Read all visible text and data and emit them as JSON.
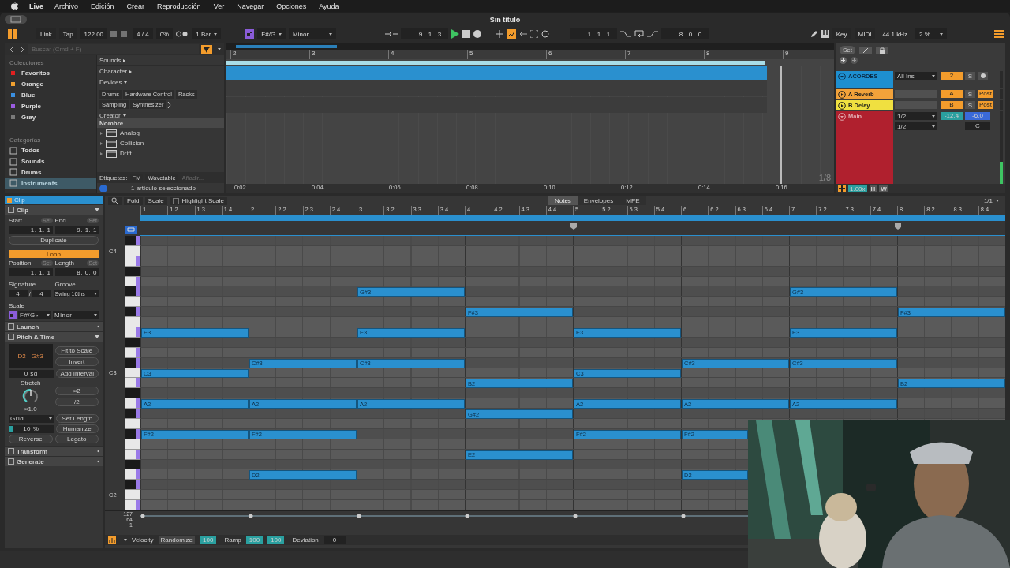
{
  "menubar": {
    "app": "Live",
    "items": [
      "Archivo",
      "Edición",
      "Crear",
      "Reproducción",
      "Ver",
      "Navegar",
      "Opciones",
      "Ayuda"
    ]
  },
  "window": {
    "title": "Sin título"
  },
  "control_bar": {
    "link": "Link",
    "tap": "Tap",
    "tempo": "122.00",
    "signature": "4 / 4",
    "groove": "0%",
    "quantize": "1 Bar",
    "scale_root": "F#/G",
    "scale_name": "Minor",
    "position": "9. 1. 3",
    "loop_start": "1. 1. 1",
    "loop_length": "8. 0. 0",
    "key": "Key",
    "midi": "MIDI",
    "sample_rate": "44.1 kHz",
    "cpu": "2 %"
  },
  "browser": {
    "search": {
      "placeholder": "Buscar (Cmd + F)"
    },
    "collections_title": "Colecciones",
    "collections": [
      {
        "label": "Favoritos",
        "color": "#e02020"
      },
      {
        "label": "Orange",
        "color": "#f0a030"
      },
      {
        "label": "Blue",
        "color": "#3a8fe0"
      },
      {
        "label": "Purple",
        "color": "#9a5ce0"
      },
      {
        "label": "Gray",
        "color": "#7a7a7a"
      }
    ],
    "categories_title": "Categorías",
    "categories": [
      {
        "label": "Todos",
        "selected": false
      },
      {
        "label": "Sounds",
        "selected": false
      },
      {
        "label": "Drums",
        "selected": false
      },
      {
        "label": "Instruments",
        "selected": true
      }
    ],
    "filters": [
      {
        "label": "Sounds",
        "expanded": false
      },
      {
        "label": "Character",
        "expanded": false
      },
      {
        "label": "Devices",
        "expanded": true,
        "tags": [
          "Drums",
          "Hardware Control",
          "Racks",
          "Sampling",
          "Synthesizer"
        ]
      },
      {
        "label": "Creator",
        "expanded": true
      }
    ],
    "list_header": "Nombre",
    "items": [
      {
        "label": "Analog"
      },
      {
        "label": "Collision"
      },
      {
        "label": "Drift"
      }
    ],
    "tags_label": "Etiquetas:",
    "tags": [
      "FM",
      "Wavetable"
    ],
    "tag_placeholder": "Añadir...",
    "status": "1 artículo seleccionado"
  },
  "arrangement": {
    "bars": [
      "2",
      "3",
      "4",
      "5",
      "6",
      "7",
      "8",
      "9"
    ],
    "times": [
      "0:02",
      "0:04",
      "0:06",
      "0:08",
      "0:10",
      "0:12",
      "0:14",
      "0:16"
    ],
    "grid": "1/8"
  },
  "mixer": {
    "set": "Set",
    "tracks": [
      {
        "kind": "midi",
        "name": "ACORDES",
        "color": "#1e8fd0",
        "expanded": true,
        "routing": [
          "All Ins"
        ],
        "send": "2",
        "solo": "S"
      },
      {
        "kind": "return",
        "name": "A Reverb",
        "color": "#f2a23a",
        "expanded": false,
        "send": "A",
        "solo": "S",
        "post": "Post"
      },
      {
        "kind": "return",
        "name": "B Delay",
        "color": "#f0e040",
        "expanded": false,
        "send": "B",
        "solo": "S",
        "post": "Post"
      },
      {
        "kind": "main",
        "name": "Main",
        "color": "#b0202e",
        "expanded": true,
        "routing": [
          "1/2",
          "1/2"
        ],
        "volume": "-12.4",
        "pan": "-6.0",
        "pan_label": "C"
      }
    ],
    "zoom": "1.00x",
    "h": "H",
    "w": "W"
  },
  "clip": {
    "tab": "Clip",
    "sections": [
      {
        "kind": "clip",
        "label": "Clip",
        "expanded": true
      },
      {
        "kind": "launch",
        "label": "Launch",
        "expanded": false
      },
      {
        "kind": "pitch",
        "label": "Pitch & Time",
        "expanded": true
      },
      {
        "kind": "transform",
        "label": "Transform",
        "expanded": false
      },
      {
        "kind": "generate",
        "label": "Generate",
        "expanded": false
      }
    ],
    "start_label": "Start",
    "start_set": "Set",
    "end_label": "End",
    "end_set": "Set",
    "start": "1. 1. 1",
    "end": "9. 1. 1",
    "duplicate": "Duplicate",
    "loop": {
      "label": "Loop",
      "on": true
    },
    "position_label": "Position",
    "position_set": "Set",
    "length_label": "Length",
    "length_set": "Set",
    "position": "1. 1. 1",
    "length": "8. 0. 0",
    "signature_label": "Signature",
    "groove_label": "Groove",
    "sig_num": "4",
    "sig_sep": "/",
    "sig_den": "4",
    "groove": "Swing 16ths",
    "scale_label": "Scale",
    "scale_root": "F#/G♭",
    "scale_name": "Minor",
    "range": "D2 - G#3",
    "fit": "Fit to Scale",
    "invert": "Invert",
    "transpose": "0 sd",
    "add_interval": "Add Interval",
    "stretch_label": "Stretch",
    "stretch": "×1.0",
    "double": "×2",
    "half": "/2",
    "grid": "Grid",
    "set_length": "Set Length",
    "humanize_amount": {
      "text": "10 %",
      "level": 0.1
    },
    "humanize": "Humanize",
    "reverse": "Reverse",
    "legato": "Legato"
  },
  "piano_roll": {
    "fold": "Fold",
    "scale": "Scale",
    "highlight_scale": {
      "label": "Highlight Scale",
      "checked": false
    },
    "tabs": [
      {
        "label": "Notes",
        "selected": true
      },
      {
        "label": "Envelopes",
        "selected": false
      },
      {
        "label": "MPE",
        "selected": false
      }
    ],
    "zoom": "1/1",
    "ruler": [
      "1",
      "1.2",
      "1.3",
      "1.4",
      "2",
      "2.2",
      "2.3",
      "2.4",
      "3",
      "3.2",
      "3.3",
      "3.4",
      "4",
      "4.2",
      "4.3",
      "4.4",
      "5",
      "5.2",
      "5.3",
      "5.4",
      "6",
      "6.2",
      "6.3",
      "6.4",
      "7",
      "7.2",
      "7.3",
      "7.4",
      "8",
      "8.2",
      "8.3",
      "8.4"
    ],
    "lanes": [
      {
        "kind": "black",
        "in_scale": true
      },
      {
        "kind": "white",
        "in_scale": false,
        "label": "C4"
      },
      {
        "kind": "white",
        "in_scale": true
      },
      {
        "kind": "black",
        "in_scale": false
      },
      {
        "kind": "white",
        "in_scale": true
      },
      {
        "kind": "black",
        "in_scale": true,
        "notes": [
          {
            "on": false
          },
          {
            "on": false
          },
          {
            "on": true,
            "label": "G#3"
          },
          {
            "on": false
          },
          {
            "on": false
          },
          {
            "on": false
          },
          {
            "on": true,
            "label": "G#3"
          }
        ]
      },
      {
        "kind": "white",
        "in_scale": false
      },
      {
        "kind": "black",
        "in_scale": true,
        "notes": [
          {
            "on": false
          },
          {
            "on": false
          },
          {
            "on": false
          },
          {
            "on": true,
            "label": "F#3"
          },
          {
            "on": false
          },
          {
            "on": false
          },
          {
            "on": false
          },
          {
            "on": true,
            "label": "F#3"
          }
        ]
      },
      {
        "kind": "white",
        "in_scale": false
      },
      {
        "kind": "white",
        "in_scale": true,
        "notes": [
          {
            "on": true,
            "label": "E3"
          },
          {
            "on": false
          },
          {
            "on": true,
            "label": "E3"
          },
          {
            "on": false
          },
          {
            "on": true,
            "label": "E3"
          },
          {
            "on": false
          },
          {
            "on": true,
            "label": "E3"
          }
        ]
      },
      {
        "kind": "black",
        "in_scale": false
      },
      {
        "kind": "white",
        "in_scale": true
      },
      {
        "kind": "black",
        "in_scale": true,
        "notes": [
          {
            "on": false
          },
          {
            "on": true,
            "label": "C#3"
          },
          {
            "on": true,
            "label": "C#3"
          },
          {
            "on": false
          },
          {
            "on": false
          },
          {
            "on": true,
            "label": "C#3"
          },
          {
            "on": true,
            "label": "C#3"
          }
        ]
      },
      {
        "kind": "white",
        "in_scale": false,
        "label": "C3",
        "notes": [
          {
            "on": true,
            "label": "C3"
          },
          {
            "on": false
          },
          {
            "on": false
          },
          {
            "on": false
          },
          {
            "on": true,
            "label": "C3"
          }
        ]
      },
      {
        "kind": "white",
        "in_scale": true,
        "notes": [
          {
            "on": false
          },
          {
            "on": false
          },
          {
            "on": false
          },
          {
            "on": true,
            "label": "B2"
          },
          {
            "on": false
          },
          {
            "on": false
          },
          {
            "on": false
          },
          {
            "on": true,
            "label": "B2"
          }
        ]
      },
      {
        "kind": "black",
        "in_scale": false
      },
      {
        "kind": "white",
        "in_scale": true,
        "notes": [
          {
            "on": true,
            "label": "A2"
          },
          {
            "on": true,
            "label": "A2"
          },
          {
            "on": true,
            "label": "A2"
          },
          {
            "on": false
          },
          {
            "on": true,
            "label": "A2"
          },
          {
            "on": true,
            "label": "A2"
          },
          {
            "on": true,
            "label": "A2"
          }
        ]
      },
      {
        "kind": "black",
        "in_scale": true,
        "notes": [
          {
            "on": false
          },
          {
            "on": false
          },
          {
            "on": false
          },
          {
            "on": true,
            "label": "G#2"
          }
        ]
      },
      {
        "kind": "white",
        "in_scale": false
      },
      {
        "kind": "black",
        "in_scale": true,
        "notes": [
          {
            "on": true,
            "label": "F#2"
          },
          {
            "on": true,
            "label": "F#2"
          },
          {
            "on": false
          },
          {
            "on": false
          },
          {
            "on": true,
            "label": "F#2"
          },
          {
            "on": true,
            "label": "F#2"
          }
        ]
      },
      {
        "kind": "white",
        "in_scale": false
      },
      {
        "kind": "white",
        "in_scale": true,
        "notes": [
          {
            "on": false
          },
          {
            "on": false
          },
          {
            "on": false
          },
          {
            "on": true,
            "label": "E2"
          }
        ]
      },
      {
        "kind": "black",
        "in_scale": false
      },
      {
        "kind": "white",
        "in_scale": true,
        "notes": [
          {
            "on": false
          },
          {
            "on": true,
            "label": "D2"
          },
          {
            "on": false
          },
          {
            "on": false
          },
          {
            "on": false
          },
          {
            "on": true,
            "label": "D2"
          }
        ]
      },
      {
        "kind": "black",
        "in_scale": true
      },
      {
        "kind": "white",
        "in_scale": false,
        "label": "C2"
      },
      {
        "kind": "white",
        "in_scale": true
      }
    ],
    "velocity_ticks": [
      "127",
      "64",
      "1"
    ]
  },
  "velocity_bar": {
    "label": "Velocity",
    "randomize": "Randomize",
    "randomize_value": "100",
    "ramp": "Ramp",
    "ramp_start": "100",
    "ramp_end": "100",
    "deviation": "Deviation",
    "deviation_value": "0"
  }
}
